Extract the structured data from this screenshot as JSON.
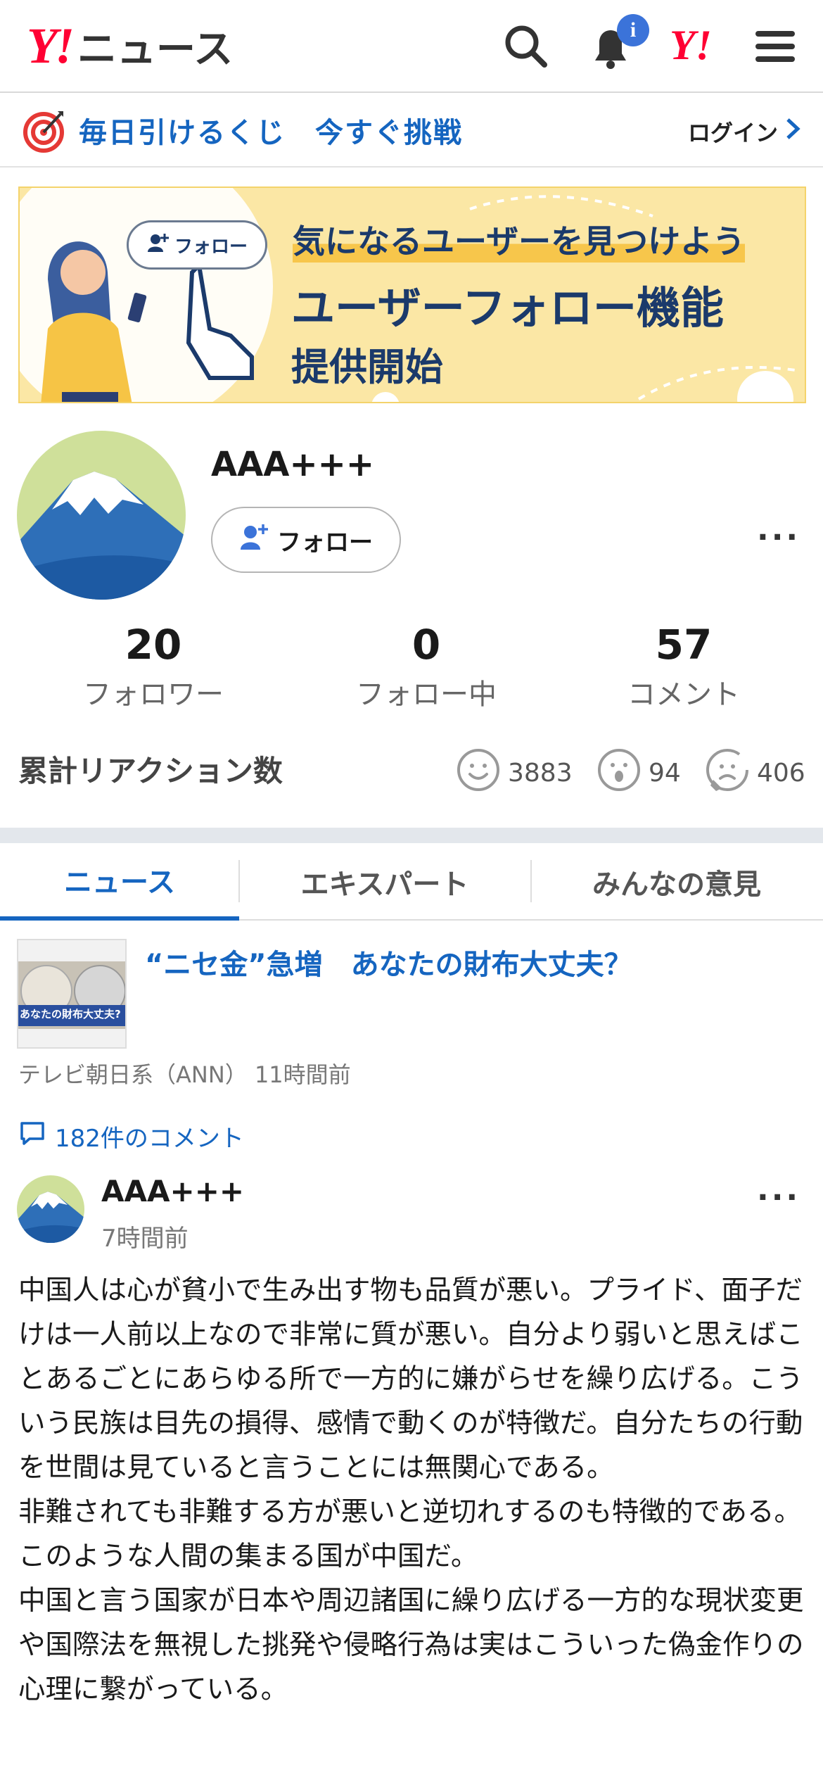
{
  "header": {
    "logo_mark": "Y!",
    "logo_text": "ニュース",
    "notification_badge": "i",
    "yahoo_mark": "Y!"
  },
  "lottery": {
    "text": "毎日引けるくじ　今すぐ挑戦",
    "login_label": "ログイン"
  },
  "banner": {
    "pill_label": "フォロー",
    "line1": "気になるユーザーを見つけよう",
    "line2": "ユーザーフォロー機能",
    "line3": "提供開始"
  },
  "profile": {
    "name": "AAA+++",
    "follow_label": "フォロー",
    "stats": [
      {
        "value": "20",
        "label": "フォロワー"
      },
      {
        "value": "0",
        "label": "フォロー中"
      },
      {
        "value": "57",
        "label": "コメント"
      }
    ],
    "reactions_title": "累計リアクション数",
    "reactions": [
      {
        "icon": "smile-icon",
        "count": "3883"
      },
      {
        "icon": "surprised-icon",
        "count": "94"
      },
      {
        "icon": "frown-icon",
        "count": "406"
      }
    ]
  },
  "tabs": [
    {
      "label": "ニュース",
      "active": true
    },
    {
      "label": "エキスパート",
      "active": false
    },
    {
      "label": "みんなの意見",
      "active": false
    }
  ],
  "article": {
    "title": "“ニセ金”急増　あなたの財布大丈夫？",
    "thumb_caption": "あなたの財布大丈夫?",
    "source": "テレビ朝日系（ANN）  11時間前",
    "comment_count": "182件のコメント"
  },
  "comment": {
    "author": "AAA+++",
    "time": "7時間前",
    "body": [
      "中国人は心が貧小で生み出す物も品質が悪い。プライド、面子だけは一人前以上なので非常に質が悪い。自分より弱いと思えばことあるごとにあらゆる所で一方的に嫌がらせを繰り広げる。こういう民族は目先の損得、感情で動くのが特徴だ。自分たちの行動を世間は見ていると言うことには無関心である。",
      "非難されても非難する方が悪いと逆切れするのも特徴的である。",
      "このような人間の集まる国が中国だ。",
      "中国と言う国家が日本や周辺諸国に繰り広げる一方的な現状変更や国際法を無視した挑発や侵略行為は実はこういった偽金作りの心理に繋がっている。"
    ]
  },
  "colors": {
    "brand_red": "#ff0033",
    "link_blue": "#1565c0",
    "badge_blue": "#3b73d9"
  }
}
